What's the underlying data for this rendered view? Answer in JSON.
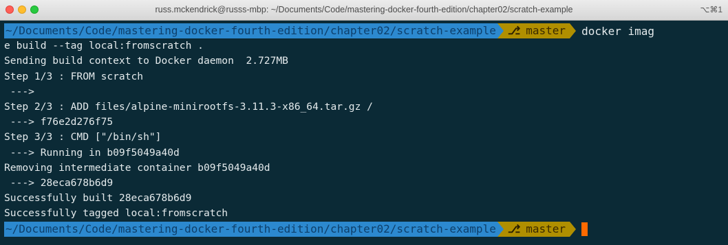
{
  "window": {
    "title": "russ.mckendrick@russs-mbp: ~/Documents/Code/mastering-docker-fourth-edition/chapter02/scratch-example",
    "shortcut": "⌥⌘1"
  },
  "prompt": {
    "path": "~/Documents/Code/mastering-docker-fourth-edition/chapter02/scratch-example",
    "branch_icon": "⎇",
    "branch": "master",
    "command_start": "docker imag",
    "command_wrap": "e build --tag local:fromscratch ."
  },
  "output": [
    "Sending build context to Docker daemon  2.727MB",
    "Step 1/3 : FROM scratch",
    " --->",
    "Step 2/3 : ADD files/alpine-minirootfs-3.11.3-x86_64.tar.gz /",
    " ---> f76e2d276f75",
    "Step 3/3 : CMD [\"/bin/sh\"]",
    " ---> Running in b09f5049a40d",
    "Removing intermediate container b09f5049a40d",
    " ---> 28eca678b6d9",
    "Successfully built 28eca678b6d9",
    "Successfully tagged local:fromscratch"
  ],
  "colors": {
    "background": "#0b2a36",
    "path_segment": "#2c89cf",
    "git_segment": "#b08f00",
    "cursor": "#ff6a00"
  },
  "icons": {
    "branch": "git-branch-icon",
    "cursor": "block-cursor"
  }
}
